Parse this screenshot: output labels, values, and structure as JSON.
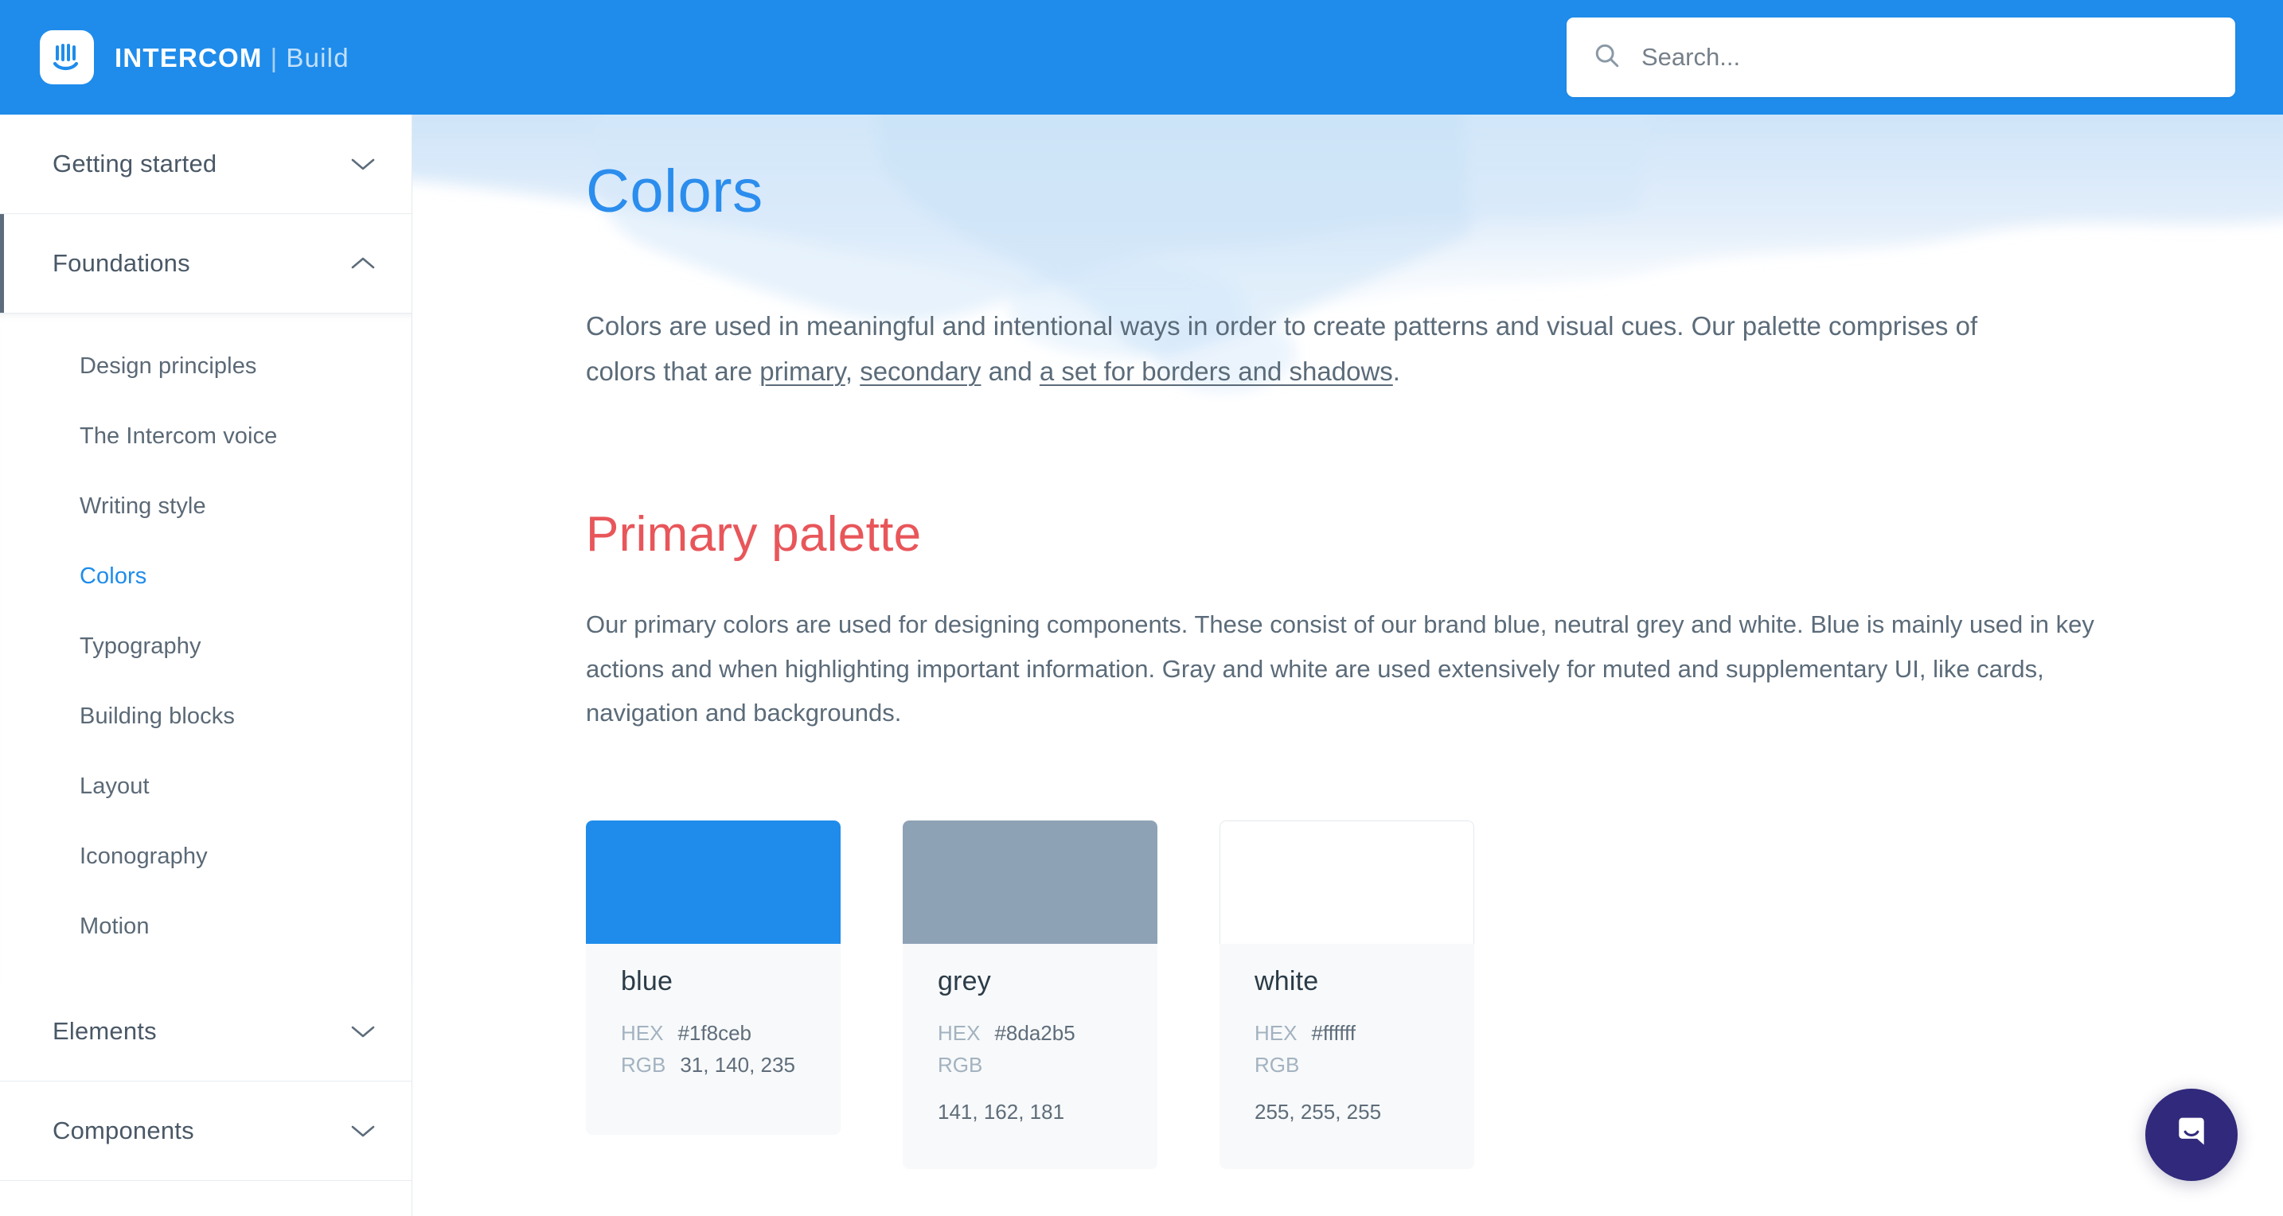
{
  "header": {
    "brand_name": "INTERCOM",
    "brand_separator": "|",
    "brand_sub": "Build",
    "logo_icon": "intercom-logo-icon",
    "search": {
      "icon": "search-icon",
      "value": "",
      "placeholder": "Search..."
    },
    "background_color": "#1f8ceb"
  },
  "sidebar": {
    "sections": [
      {
        "label": "Getting started",
        "expanded": false,
        "active": false,
        "chevron": "chevron-down-icon",
        "items": []
      },
      {
        "label": "Foundations",
        "expanded": true,
        "active": true,
        "chevron": "chevron-up-icon",
        "items": [
          {
            "label": "Design principles",
            "current": false
          },
          {
            "label": "The Intercom voice",
            "current": false
          },
          {
            "label": "Writing style",
            "current": false
          },
          {
            "label": "Colors",
            "current": true
          },
          {
            "label": "Typography",
            "current": false
          },
          {
            "label": "Building blocks",
            "current": false
          },
          {
            "label": "Layout",
            "current": false
          },
          {
            "label": "Iconography",
            "current": false
          },
          {
            "label": "Motion",
            "current": false
          }
        ]
      },
      {
        "label": "Elements",
        "expanded": false,
        "active": false,
        "chevron": "chevron-down-icon",
        "items": []
      },
      {
        "label": "Components",
        "expanded": false,
        "active": false,
        "chevron": "chevron-down-icon",
        "items": []
      }
    ],
    "active_accent_color": "#5d6c7b",
    "current_link_color": "#1f8ceb"
  },
  "main": {
    "page_title": "Colors",
    "page_title_color": "#2b8ded",
    "intro": {
      "before_links": "Colors are used in meaningful and intentional ways in order to create patterns and visual cues. Our palette comprises of colors that are ",
      "link_primary": "primary",
      "between_1": ", ",
      "link_secondary": "secondary",
      "between_2": " and ",
      "link_borders": "a set for borders and shadows",
      "after_links": "."
    },
    "section": {
      "title": "Primary palette",
      "title_color": "#e8565a",
      "body": "Our primary colors are used for designing components. These consist of our brand blue, neutral grey and white. Blue is mainly used in key actions and when highlighting important information. Gray and white are used extensively for muted and supplementary UI, like cards, navigation and backgrounds."
    },
    "swatch_labels": {
      "hex": "HEX",
      "rgb": "RGB"
    },
    "swatches": [
      {
        "name": "blue",
        "hex": "#1f8ceb",
        "rgb": "31, 140, 235",
        "bordered": false
      },
      {
        "name": "grey",
        "hex": "#8da2b5",
        "rgb": "141, 162, 181",
        "bordered": false
      },
      {
        "name": "white",
        "hex": "#ffffff",
        "rgb": "255, 255, 255",
        "bordered": true
      }
    ]
  },
  "chat": {
    "icon": "intercom-chat-bubble-icon",
    "color": "#31297c"
  }
}
